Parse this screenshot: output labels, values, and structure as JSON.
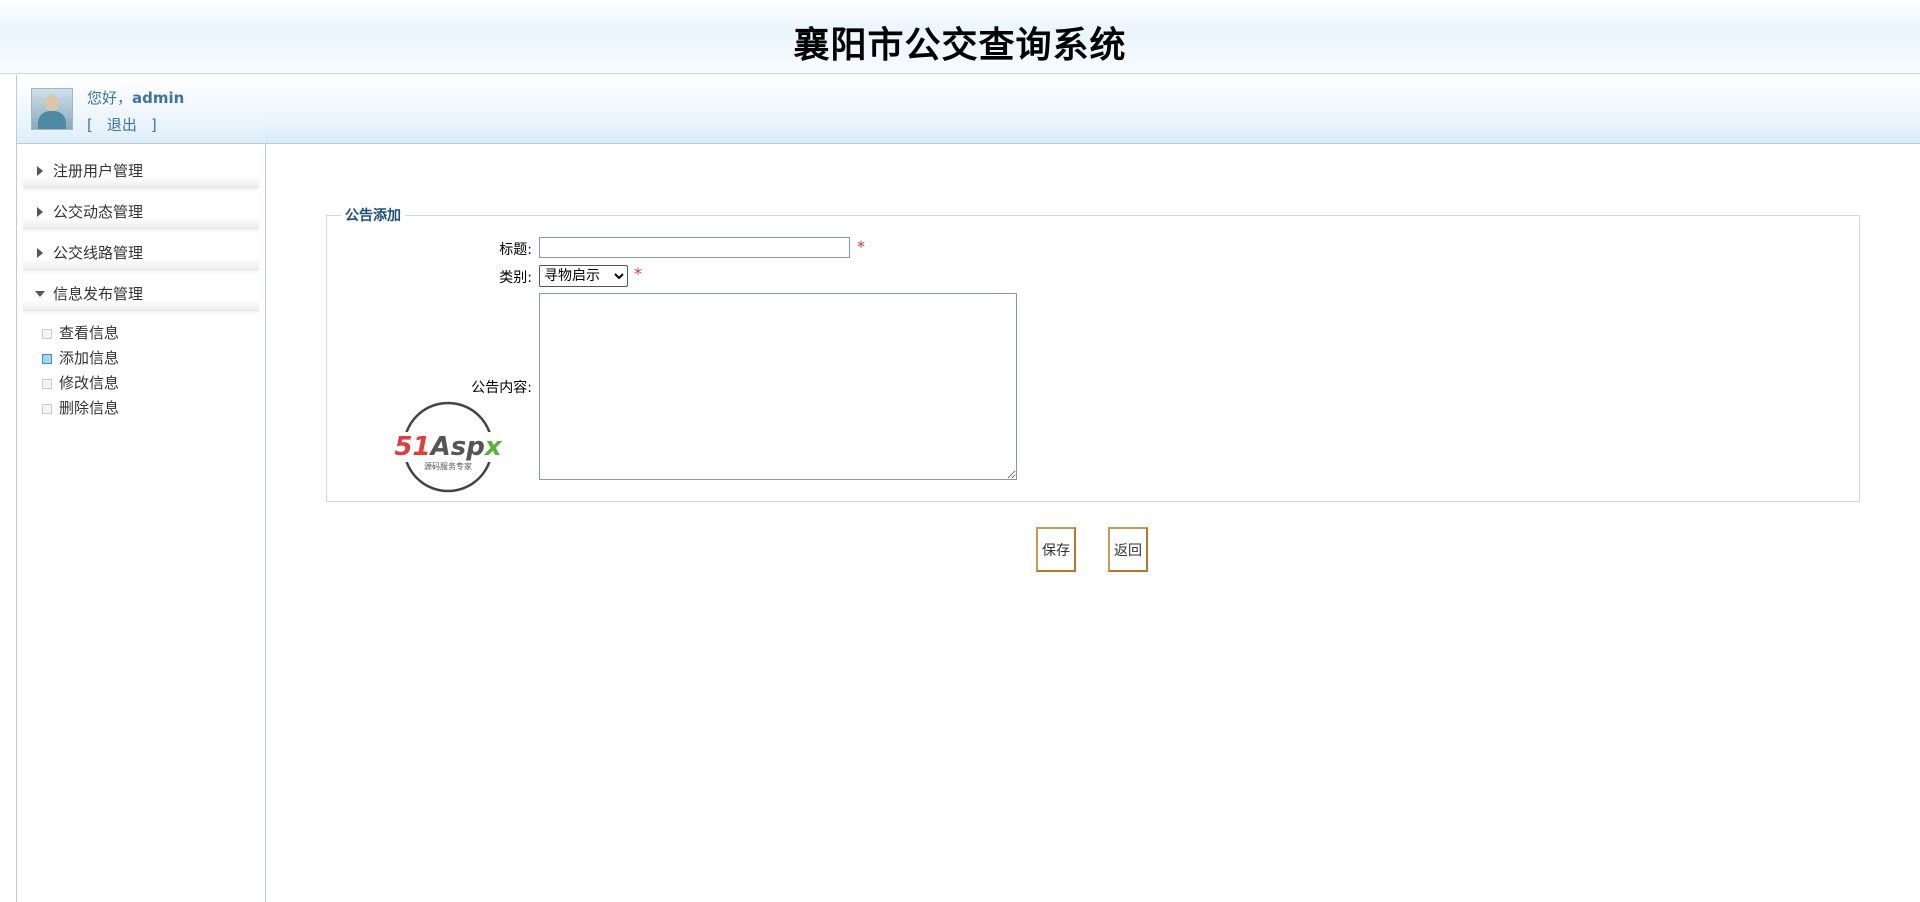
{
  "header": {
    "title": "襄阳市公交查询系统"
  },
  "user": {
    "greeting": "您好，",
    "name": "admin",
    "logout_open": "[",
    "logout_label": "退出",
    "logout_close": "]"
  },
  "sidebar": {
    "groups": [
      {
        "label": "注册用户管理",
        "expanded": false
      },
      {
        "label": "公交动态管理",
        "expanded": false
      },
      {
        "label": "公交线路管理",
        "expanded": false
      },
      {
        "label": "信息发布管理",
        "expanded": true
      }
    ],
    "subitems": [
      {
        "label": "查看信息",
        "active": false
      },
      {
        "label": "添加信息",
        "active": true
      },
      {
        "label": "修改信息",
        "active": false
      },
      {
        "label": "删除信息",
        "active": false
      }
    ]
  },
  "form": {
    "legend": "公告添加",
    "title_label": "标题:",
    "title_value": "",
    "category_label": "类别:",
    "category_value": "寻物启示",
    "content_label": "公告内容:",
    "content_value": "",
    "required_mark": "*"
  },
  "watermark": {
    "brand": "51Aspx",
    "tagline": "源码服务专家"
  },
  "actions": {
    "save_label": "保存",
    "back_label": "返回"
  },
  "colors": {
    "accent": "#1e4e79",
    "link": "#3b75a6",
    "required": "#dd3333",
    "button_border": "#b07a2a"
  }
}
